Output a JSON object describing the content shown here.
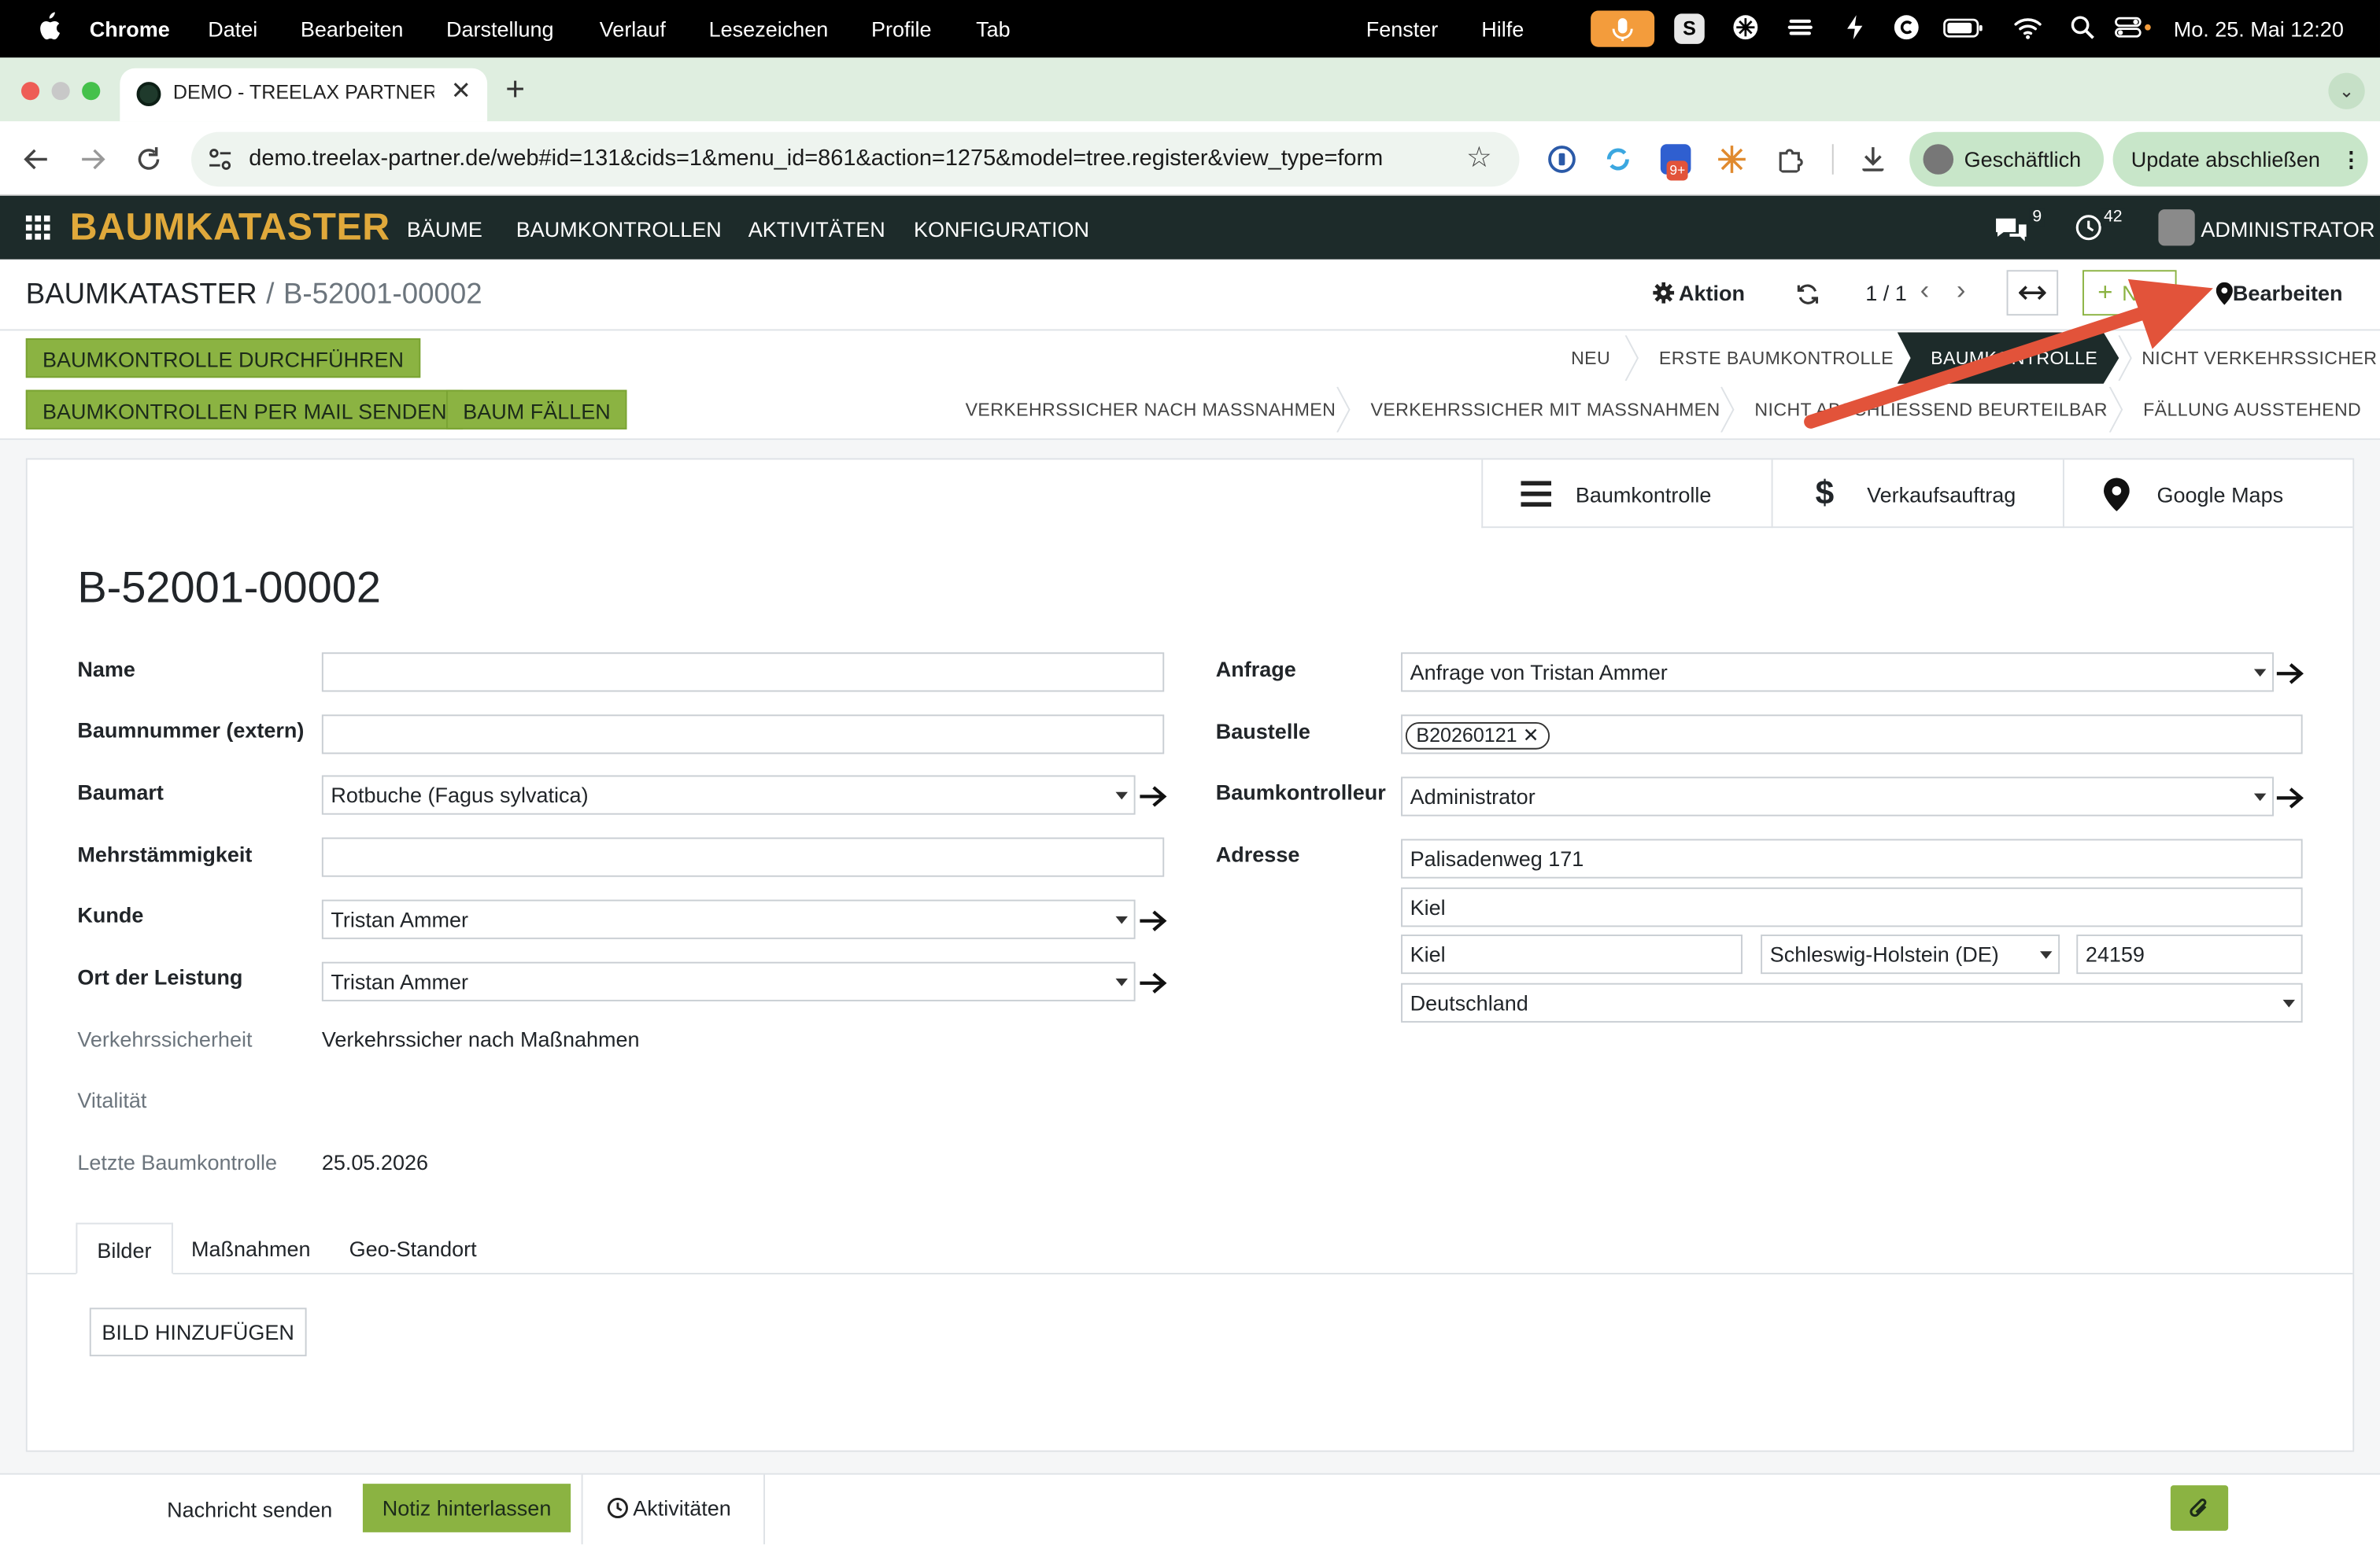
{
  "macos": {
    "app": "Chrome",
    "menus": [
      "Datei",
      "Bearbeiten",
      "Darstellung",
      "Verlauf",
      "Lesezeichen",
      "Profile",
      "Tab",
      "Fenster",
      "Hilfe"
    ],
    "clock": "Mo. 25. Mai  12:20"
  },
  "browser": {
    "tab_title": "DEMO - TREELAX PARTNER -",
    "url": "demo.treelax-partner.de/web#id=131&cids=1&menu_id=861&action=1275&model=tree.register&view_type=form",
    "extension_badge": "9+",
    "profile_label": "Geschäftlich",
    "update_label": "Update abschließen"
  },
  "app_nav": {
    "brand": "BAUMKATASTER",
    "menus": [
      "BÄUME",
      "BAUMKONTROLLEN",
      "AKTIVITÄTEN",
      "KONFIGURATION"
    ],
    "messages_count": "9",
    "activities_count": "42",
    "user": "ADMINISTRATOR"
  },
  "control_panel": {
    "breadcrumb_root": "BAUMKATASTER",
    "breadcrumb_sep": "/",
    "breadcrumb_current": "B-52001-00002",
    "action_label": "Aktion",
    "pager": "1 / 1",
    "new_label": "Neu",
    "edit_label": "Bearbeiten"
  },
  "actions": {
    "perform_check": "BAUMKONTROLLE DURCHFÜHREN",
    "send_mail": "BAUMKONTROLLEN PER MAIL SENDEN",
    "fell_tree": "BAUM FÄLLEN"
  },
  "stages": {
    "row1": [
      "NEU",
      "ERSTE BAUMKONTROLLE",
      "BAUMKONTROLLE",
      "NICHT VERKEHRSSICHER"
    ],
    "active": "BAUMKONTROLLE",
    "row2": [
      "VERKEHRSSICHER NACH MASSNAHMEN",
      "VERKEHRSSICHER MIT MASSNAHMEN",
      "NICHT ABSCHLIESSEND BEURTEILBAR",
      "FÄLLUNG AUSSTEHEND"
    ]
  },
  "smart_buttons": [
    "Baumkontrolle",
    "Verkaufsauftrag",
    "Google Maps"
  ],
  "record": {
    "title": "B-52001-00002",
    "labels": {
      "name": "Name",
      "ext_number": "Baumnummer (extern)",
      "species": "Baumart",
      "multi_stem": "Mehrstämmigkeit",
      "customer": "Kunde",
      "service_location": "Ort der Leistung",
      "traffic_safety": "Verkehrssicherheit",
      "vitality": "Vitalität",
      "last_check": "Letzte Baumkontrolle",
      "request": "Anfrage",
      "site": "Baustelle",
      "inspector": "Baumkontrolleur",
      "address": "Adresse"
    },
    "values": {
      "name": "",
      "ext_number": "",
      "species": "Rotbuche (Fagus sylvatica)",
      "multi_stem": "",
      "customer": "Tristan Ammer",
      "service_location": "Tristan Ammer",
      "traffic_safety": "Verkehrssicher nach Maßnahmen",
      "vitality": "",
      "last_check": "25.05.2026",
      "request": "Anfrage von Tristan Ammer",
      "site_tag": "B20260121",
      "inspector": "Administrator",
      "street": "Palisadenweg 171",
      "street2": "Kiel",
      "city": "Kiel",
      "state": "Schleswig-Holstein (DE)",
      "zip": "24159",
      "country": "Deutschland"
    }
  },
  "notebook": {
    "tabs": [
      "Bilder",
      "Maßnahmen",
      "Geo-Standort"
    ],
    "add_image": "BILD HINZUFÜGEN"
  },
  "chatter": {
    "send_message": "Nachricht senden",
    "log_note": "Notiz hinterlassen",
    "activities": "Aktivitäten"
  },
  "colors": {
    "navbar": "#1d2b2a",
    "brand": "#e0a93b",
    "button_green": "#8bb342",
    "annotation_arrow": "#e2533a"
  }
}
